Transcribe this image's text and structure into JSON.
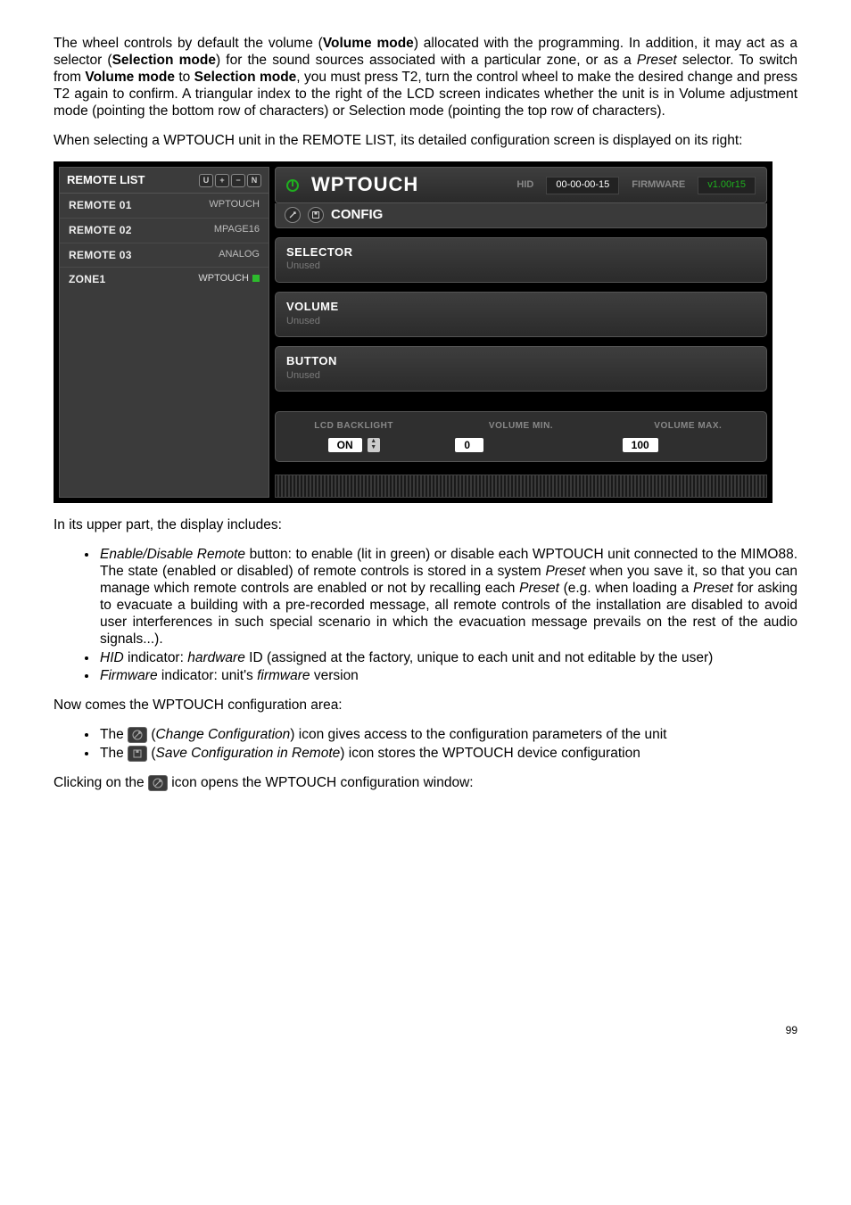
{
  "para1_a": "The wheel controls  by default the volume (",
  "para1_b": "Volume mode",
  "para1_c": ") allocated with the programming. In addition, it may act as a selector (",
  "para1_d": "Selection mode",
  "para1_e": ") for the sound sources associated with a particular zone, or as a ",
  "para1_f": "Preset",
  "para1_g": " selector. To switch from ",
  "para1_h": "Volume mode",
  "para1_i": " to ",
  "para1_j": "Selection mode",
  "para1_k": ", you must press T2, turn the control wheel to make the desired change and press T2 again to confirm. A triangular index to the right of the LCD screen indicates whether the unit is in Volume adjustment mode (pointing the bottom row of characters) or Selection mode (pointing the top row of characters).",
  "para2": "When selecting a WPTOUCH unit in the REMOTE LIST, its detailed configuration screen is displayed on its right:",
  "shot": {
    "left_title": "REMOTE LIST",
    "tbtns": [
      "U",
      "+",
      "−",
      "N"
    ],
    "rows": [
      {
        "name": "REMOTE 01",
        "type": "WPTOUCH",
        "sel": false,
        "dot": false
      },
      {
        "name": "REMOTE 02",
        "type": "MPAGE16",
        "sel": false,
        "dot": false
      },
      {
        "name": "REMOTE 03",
        "type": "ANALOG",
        "sel": false,
        "dot": false
      },
      {
        "name": "ZONE1",
        "type": "WPTOUCH",
        "sel": true,
        "dot": true
      }
    ],
    "title": "WPTOUCH",
    "hid_label": "HID",
    "hid_value": "00-00-00-15",
    "fw_label": "FIRMWARE",
    "fw_value": "v1.00r15",
    "config_label": "CONFIG",
    "cards": [
      {
        "title": "SELECTOR",
        "sub": "Unused"
      },
      {
        "title": "VOLUME",
        "sub": "Unused"
      },
      {
        "title": "BUTTON",
        "sub": "Unused"
      }
    ],
    "foot": {
      "backlight_label": "LCD BACKLIGHT",
      "backlight_value": "ON",
      "volmin_label": "VOLUME MIN.",
      "volmin_value": "0",
      "volmax_label": "VOLUME MAX.",
      "volmax_value": "100"
    }
  },
  "para3": "In its upper part, the display includes:",
  "li1_a": "Enable/Disable Remote",
  "li1_b": " button: to enable (lit in green) or disable each WPTOUCH unit connected to the MIMO88. The state (enabled or disabled) of remote controls is stored in a system ",
  "li1_c": "Preset",
  "li1_d": " when you save it, so that you can manage which remote controls are enabled or not by recalling each ",
  "li1_e": "Preset",
  "li1_f": " (e.g. when loading a ",
  "li1_g": "Preset",
  "li1_h": " for asking to evacuate a building with a pre-recorded message, all remote controls of the installation are disabled to avoid user interferences in such special scenario in which the evacuation message prevails on the rest of the audio signals...).",
  "li2_a": "HID",
  "li2_b": " indicator: ",
  "li2_c": "hardware",
  "li2_d": " ID (assigned at the factory, unique to each unit and not editable by the user)",
  "li3_a": "Firmware",
  "li3_b": " indicator: unit's ",
  "li3_c": "firmware",
  "li3_d": " version",
  "para4": "Now comes the WPTOUCH configuration area:",
  "li4_a": "The ",
  "li4_b": " (",
  "li4_c": "Change Configuration",
  "li4_d": ")  icon gives access to the configuration parameters of the unit",
  "li5_a": "The ",
  "li5_b": " (",
  "li5_c": "Save Configuration in Remote",
  "li5_d": ") icon stores the WPTOUCH device configuration",
  "para5_a": "Clicking on the ",
  "para5_b": " icon opens the WPTOUCH configuration window:",
  "pagenum": "99"
}
